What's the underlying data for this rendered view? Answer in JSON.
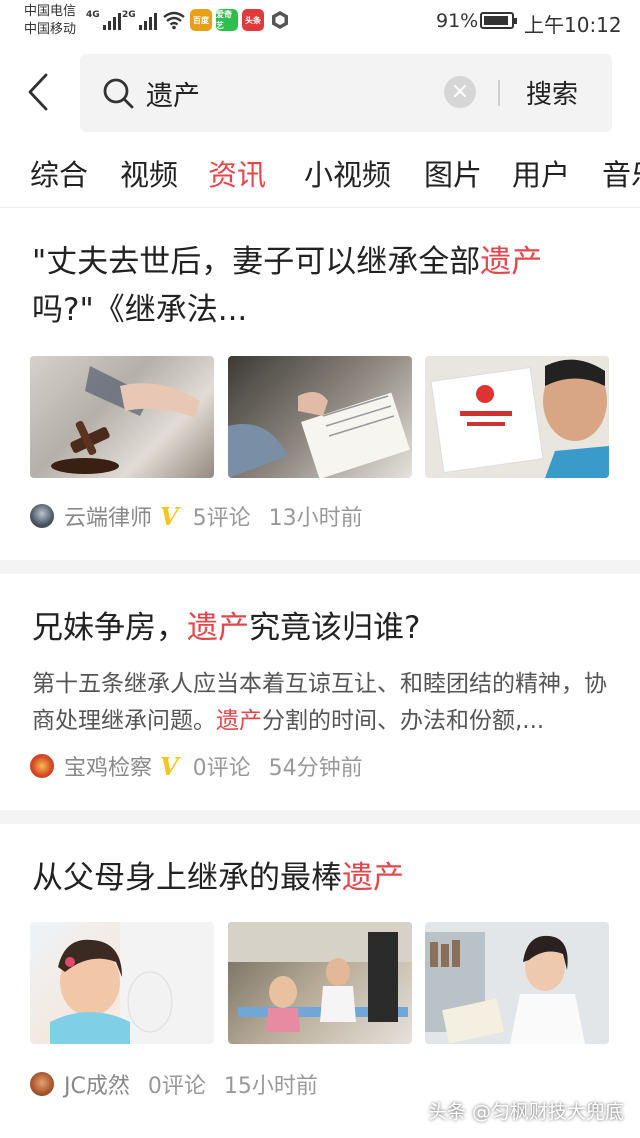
{
  "status_bar": {
    "carrier_1": "中国电信",
    "carrier_2": "中国移动",
    "net_1": "4G",
    "net_2": "2G",
    "battery": "91%",
    "battery_level": 0.91,
    "time": "上午10:12",
    "app_icons": [
      "百度",
      "爱奇艺",
      "头条"
    ]
  },
  "search": {
    "query": "遗产",
    "button_label": "搜索"
  },
  "tabs": [
    {
      "label": "综合",
      "active": false
    },
    {
      "label": "视频",
      "active": false
    },
    {
      "label": "资讯",
      "active": true
    },
    {
      "label": "小视频",
      "active": false
    },
    {
      "label": "图片",
      "active": false
    },
    {
      "label": "用户",
      "active": false
    },
    {
      "label": "音乐",
      "active": false
    }
  ],
  "feed": [
    {
      "title_pre": "\"丈夫去世后，妻子可以继承全部",
      "title_hl": "遗产",
      "title_post": "吗?\"《继承法...",
      "author": "云端律师",
      "verified": "V",
      "comments": "5评论",
      "time": "13小时前"
    },
    {
      "title_pre": "兄妹争房，",
      "title_hl": "遗产",
      "title_post": "究竟该归谁?",
      "summary_pre": "第十五条继承人应当本着互谅互让、和睦团结的精神，协商处理继承问题。",
      "summary_hl": "遗产",
      "summary_post": "分割的时间、办法和份额,...",
      "author": "宝鸡检察",
      "verified": "V",
      "comments": "0评论",
      "time": "54分钟前"
    },
    {
      "title_pre": "从父母身上继承的最棒",
      "title_hl": "遗产",
      "title_post": "",
      "author": "JC成然",
      "comments": "0评论",
      "time": "15小时前"
    }
  ],
  "watermark": "头条 @匀枫财技大兜底",
  "colors": {
    "accent": "#e4474b",
    "verified": "#f5c518",
    "meta_text": "#999999"
  },
  "icons": [
    "back-arrow-icon",
    "search-icon",
    "clear-icon",
    "wifi-icon",
    "battery-icon",
    "verified-icon"
  ]
}
